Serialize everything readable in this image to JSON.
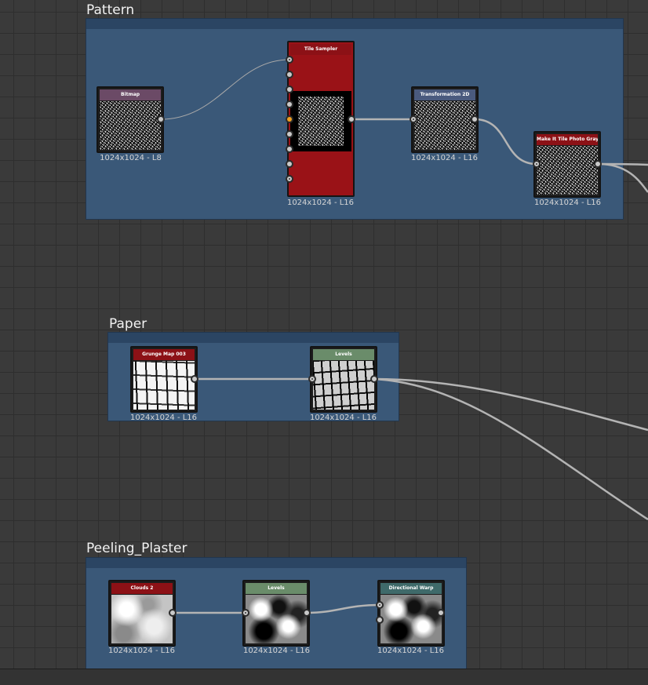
{
  "frames": {
    "pattern": {
      "title": "Pattern"
    },
    "paper": {
      "title": "Paper"
    },
    "peeling": {
      "title": "Peeling_Plaster"
    }
  },
  "nodes": {
    "bitmap": {
      "title": "Bitmap",
      "res": "1024x1024 - L8",
      "header_color": "#6b4a66"
    },
    "tile_sampler": {
      "title": "Tile Sampler",
      "res": "1024x1024 - L16",
      "header_color": "#8c1116"
    },
    "transformation": {
      "title": "Transformation 2D",
      "res": "1024x1024 - L16",
      "header_color": "#4a5a7e"
    },
    "make_tile": {
      "title": "Make It Tile Photo Gray...",
      "res": "1024x1024 - L16",
      "header_color": "#8c1116"
    },
    "grunge_map": {
      "title": "Grunge Map 003",
      "res": "1024x1024 - L16",
      "header_color": "#8c1116"
    },
    "levels_paper": {
      "title": "Levels",
      "res": "1024x1024 - L16",
      "header_color": "#6a8c6a"
    },
    "clouds2": {
      "title": "Clouds 2",
      "res": "1024x1024 - L16",
      "header_color": "#8c1116"
    },
    "levels_plaster": {
      "title": "Levels",
      "res": "1024x1024 - L16",
      "header_color": "#6a8c6a"
    },
    "dir_warp": {
      "title": "Directional Warp",
      "res": "1024x1024 - L16",
      "header_color": "#3f6a6a"
    }
  },
  "colors": {
    "canvas": "#3a3a3a",
    "frame": "#3a5878",
    "wire": "#b4b4b4",
    "active_port": "#f0a020"
  }
}
